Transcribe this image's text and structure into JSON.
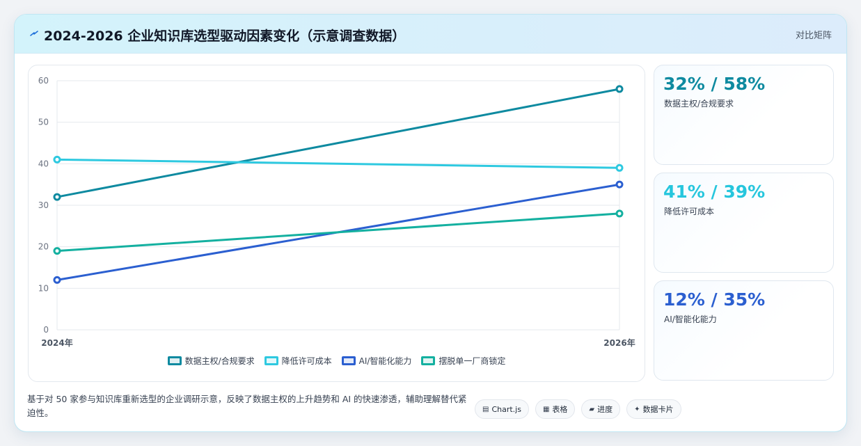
{
  "header": {
    "icon": "lightning-icon",
    "title": "2024-2026 企业知识库选型驱动因素变化（示意调查数据）",
    "right_label": "对比矩阵"
  },
  "chart_data": {
    "type": "line",
    "title": "",
    "x": [
      "2024年",
      "2026年"
    ],
    "ylim": [
      0,
      60
    ],
    "yticks": [
      0,
      10,
      20,
      30,
      40,
      50,
      60
    ],
    "grid": true,
    "legend": "bottom",
    "series": [
      {
        "name": "数据主权/合规要求",
        "values": [
          32,
          58
        ],
        "color": "#0e8aa0"
      },
      {
        "name": "降低许可成本",
        "values": [
          41,
          39
        ],
        "color": "#2ec9e0"
      },
      {
        "name": "AI/智能化能力",
        "values": [
          12,
          35
        ],
        "color": "#2b5fd0"
      },
      {
        "name": "摆脱单一厂商锁定",
        "values": [
          19,
          28
        ],
        "color": "#14b0a0"
      }
    ]
  },
  "stats": [
    {
      "value": "32% / 58%",
      "label": "数据主权/合规要求",
      "color": "#0e8aa0"
    },
    {
      "value": "41% / 39%",
      "label": "降低许可成本",
      "color": "#26c6dd"
    },
    {
      "value": "12% / 35%",
      "label": "AI/智能化能力",
      "color": "#2b5fd0"
    }
  ],
  "note": "基于对 50 家参与知识库重新选型的企业调研示意，反映了数据主权的上升趋势和 AI 的快速渗透，辅助理解替代紧迫性。",
  "chips": [
    {
      "icon": "chart-icon",
      "glyph": "▤",
      "label": "Chart.js"
    },
    {
      "icon": "table-icon",
      "glyph": "▦",
      "label": "表格"
    },
    {
      "icon": "progress-icon",
      "glyph": "▰",
      "label": "进度"
    },
    {
      "icon": "sparkle-icon",
      "glyph": "✦",
      "label": "数据卡片"
    }
  ]
}
